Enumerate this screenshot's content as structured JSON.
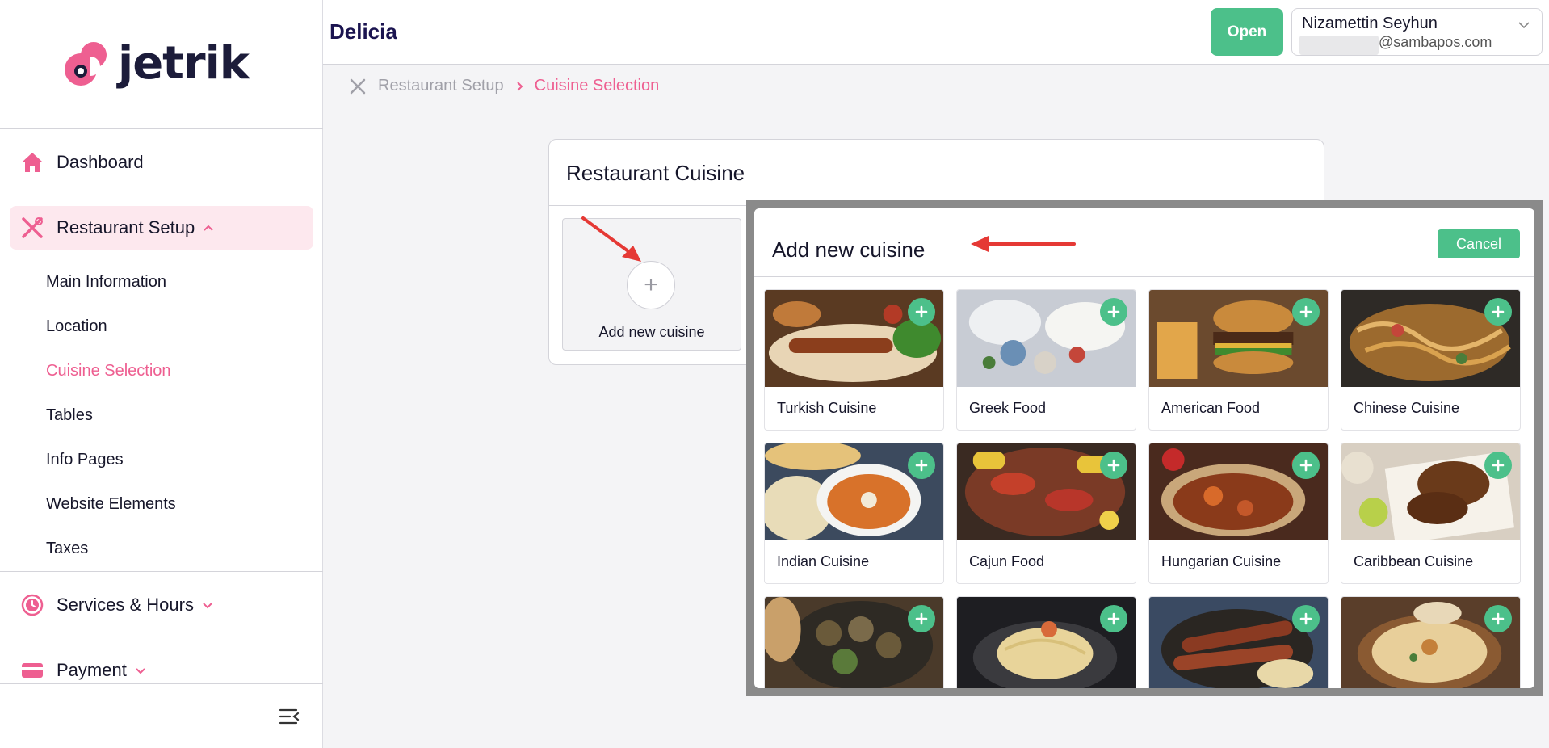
{
  "sidebar": {
    "logo_text": "jetrik",
    "items": {
      "dashboard": "Dashboard",
      "restaurant_setup": "Restaurant Setup",
      "services_hours": "Services & Hours",
      "payment": "Payment"
    },
    "sub_items": [
      "Main Information",
      "Location",
      "Cuisine Selection",
      "Tables",
      "Info Pages",
      "Website Elements",
      "Taxes"
    ],
    "active_sub_item": "Cuisine Selection"
  },
  "header": {
    "brand": "Delicia",
    "status_button": "Open",
    "user_name": "Nizamettin Seyhun",
    "user_email_domain": "@sambapos.com"
  },
  "breadcrumb": {
    "parent": "Restaurant Setup",
    "current": "Cuisine Selection"
  },
  "restaurant_cuisine": {
    "title": "Restaurant Cuisine",
    "add_label": "Add new cuisine"
  },
  "modal": {
    "title": "Add new cuisine",
    "cancel_label": "Cancel",
    "cuisines": [
      {
        "name": "Turkish Cuisine"
      },
      {
        "name": "Greek Food"
      },
      {
        "name": "American Food"
      },
      {
        "name": "Chinese Cuisine"
      },
      {
        "name": "Indian Cuisine"
      },
      {
        "name": "Cajun Food"
      },
      {
        "name": "Hungarian Cuisine"
      },
      {
        "name": "Caribbean Cuisine"
      },
      {
        "name": ""
      },
      {
        "name": ""
      },
      {
        "name": ""
      },
      {
        "name": ""
      }
    ]
  },
  "colors": {
    "accent_pink": "#ee5f91",
    "action_green": "#4cc08a",
    "brand_navy": "#1b1450",
    "annotation_red": "#e53935"
  }
}
